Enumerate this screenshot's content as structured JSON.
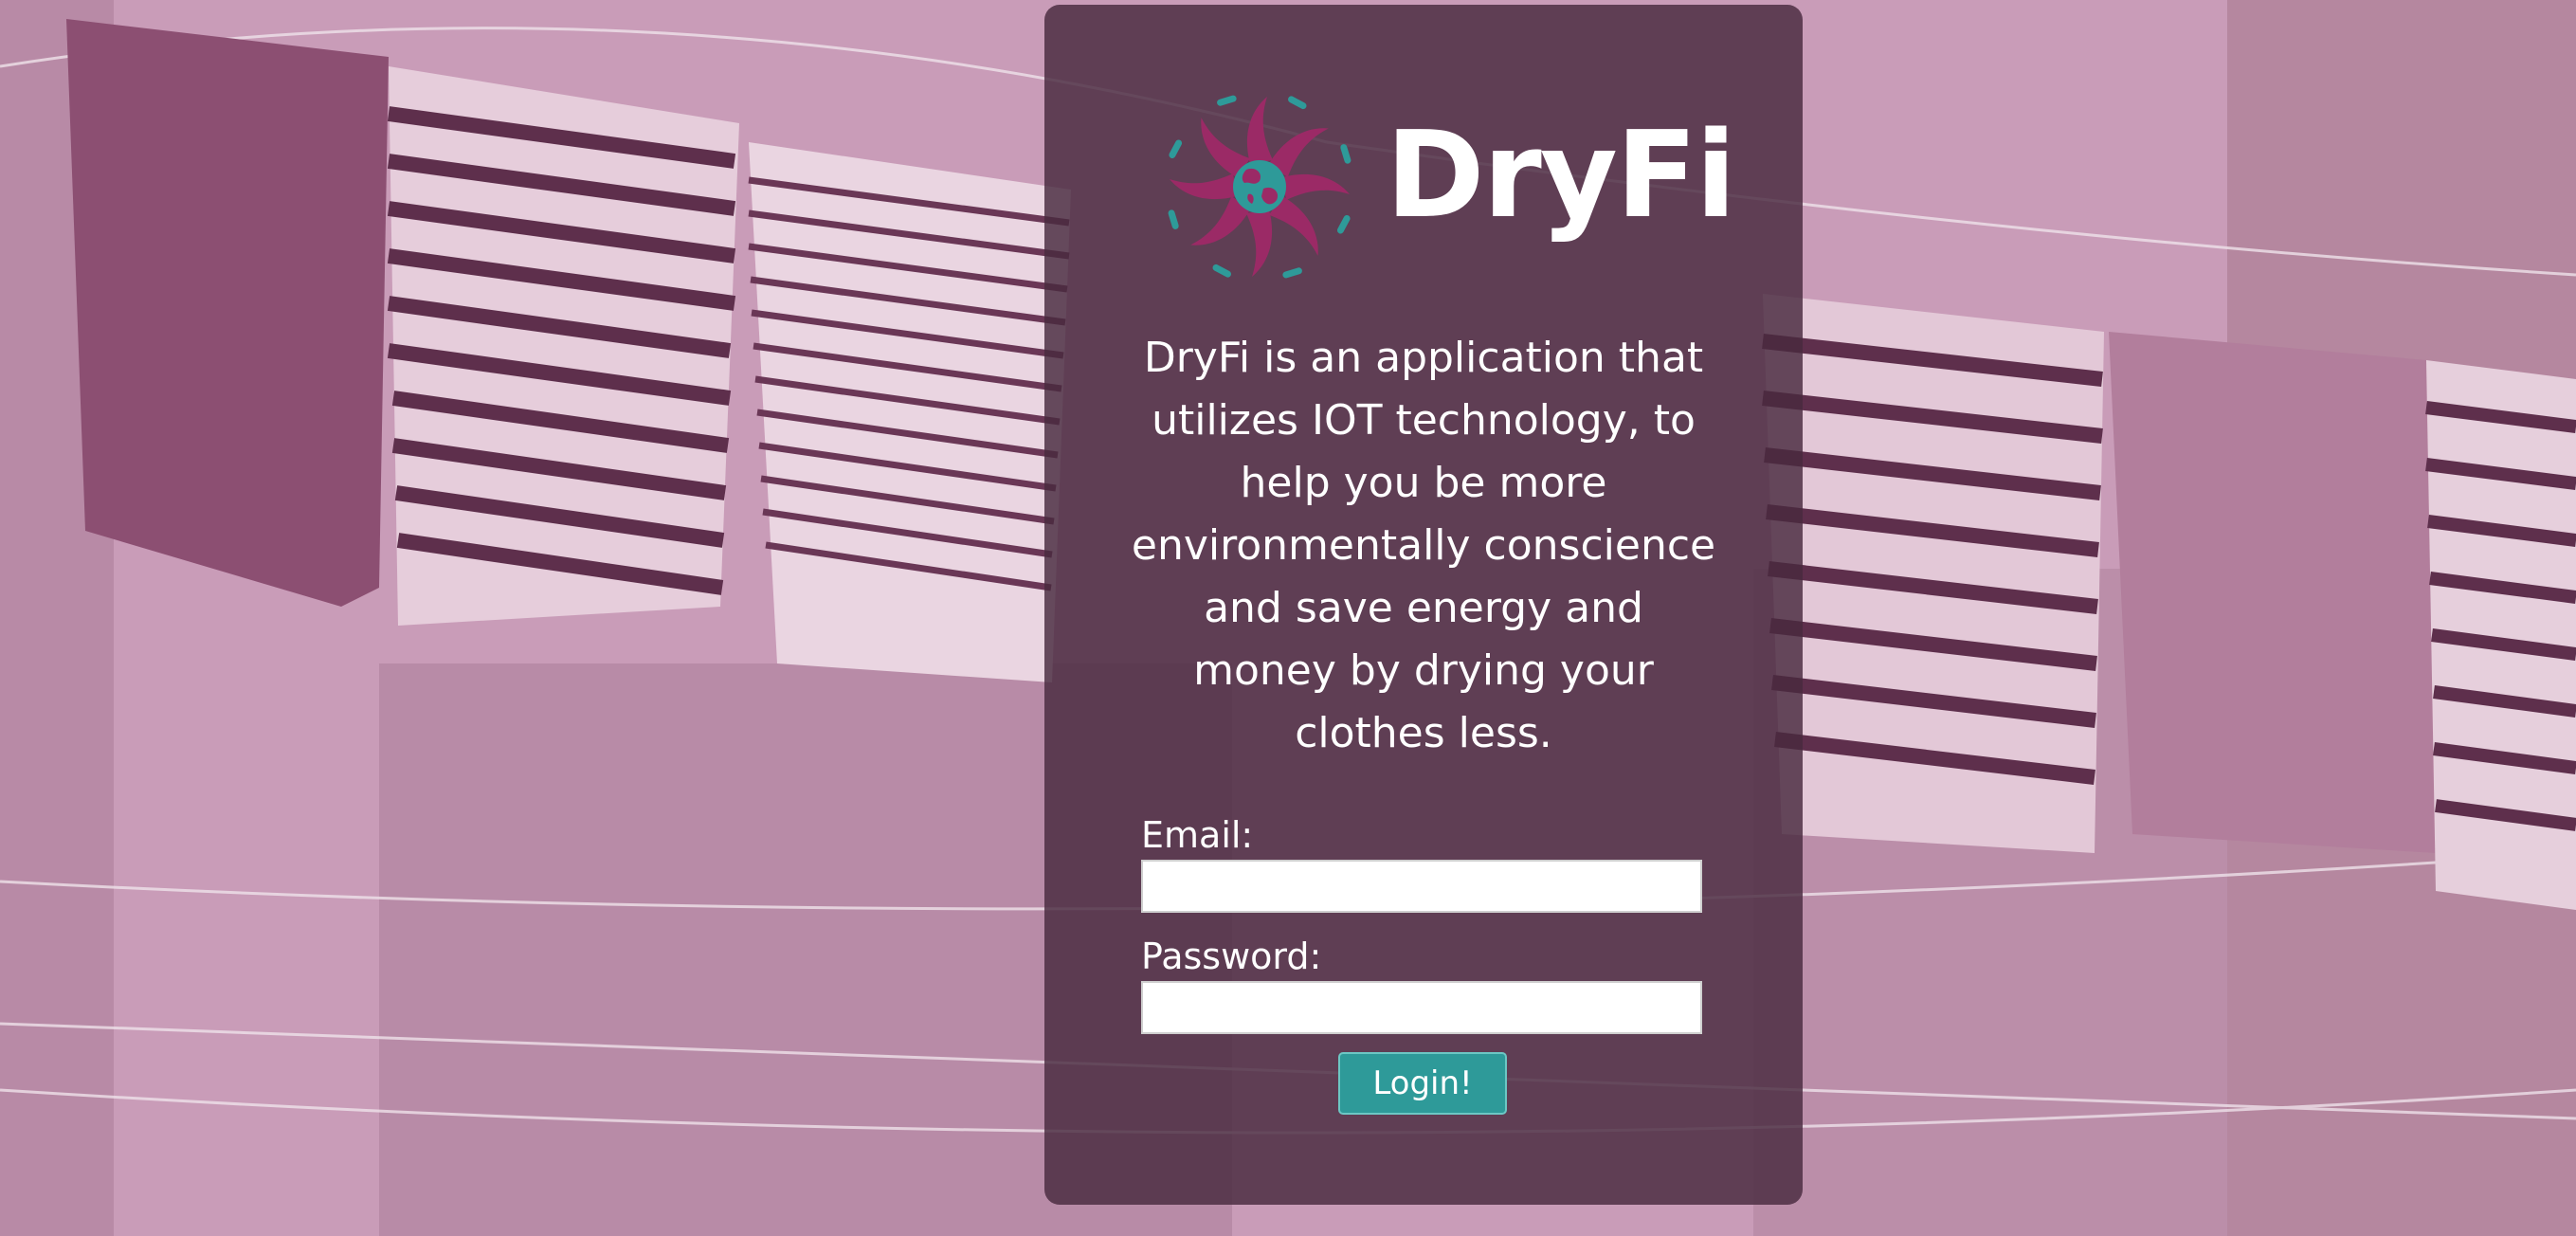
{
  "app": {
    "name": "DryFi",
    "description": "DryFi is an application that utilizes IOT technology, to help you be more environmentally conscience and save energy and money by drying your clothes less.",
    "logo_icon": "sun-globe-icon",
    "background_image": "laundry-clothesline-photo"
  },
  "login_form": {
    "email_label": "Email:",
    "email_value": "",
    "password_label": "Password:",
    "password_value": "",
    "submit_label": "Login!"
  },
  "colors": {
    "background_tint": "#c79ab6",
    "panel": "#482a3e",
    "logo_magenta": "#9b2a66",
    "logo_teal": "#2e9a99",
    "button": "#2e9a99",
    "text": "#ffffff"
  }
}
